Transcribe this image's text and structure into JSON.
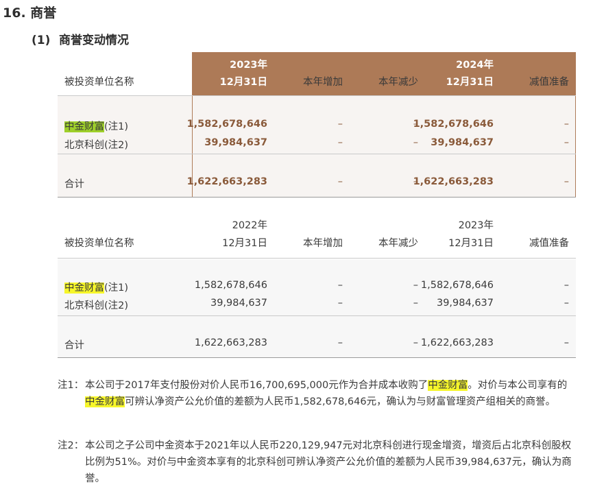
{
  "section": {
    "number": "16.",
    "title": "商誉"
  },
  "subsection": {
    "number": "(1)",
    "title": "商誉变动情况"
  },
  "table_2023": {
    "headers": {
      "name": "被投资单位名称",
      "col1_line1": "2023年",
      "col1_line2": "12月31日",
      "col2": "本年增加",
      "col3": "本年减少",
      "col4_line1": "2024年",
      "col4_line2": "12月31日",
      "col5": "减值准备"
    },
    "rows": [
      {
        "name_hl": "中金财富",
        "note": "(注1)",
        "opening": "1,582,678,646",
        "increase": "–",
        "decrease": "–",
        "closing": "1,582,678,646",
        "impairment": "–"
      },
      {
        "name": "北京科创(注2)",
        "opening": "39,984,637",
        "increase": "–",
        "decrease": "–",
        "closing": "39,984,637",
        "impairment": "–"
      }
    ],
    "total": {
      "name": "合计",
      "opening": "1,622,663,283",
      "increase": "–",
      "decrease": "–",
      "closing": "1,622,663,283",
      "impairment": "–"
    }
  },
  "table_2022": {
    "headers": {
      "name": "被投资单位名称",
      "col1_line1": "2022年",
      "col1_line2": "12月31日",
      "col2": "本年增加",
      "col3": "本年减少",
      "col4_line1": "2023年",
      "col4_line2": "12月31日",
      "col5": "减值准备"
    },
    "rows": [
      {
        "name_hl": "中金财富",
        "note": "(注1)",
        "opening": "1,582,678,646",
        "increase": "–",
        "decrease": "–",
        "closing": "1,582,678,646",
        "impairment": "–"
      },
      {
        "name": "北京科创(注2)",
        "opening": "39,984,637",
        "increase": "–",
        "decrease": "–",
        "closing": "39,984,637",
        "impairment": "–"
      }
    ],
    "total": {
      "name": "合计",
      "opening": "1,622,663,283",
      "increase": "–",
      "decrease": "–",
      "closing": "1,622,663,283",
      "impairment": "–"
    }
  },
  "notes": [
    {
      "tag": "注1：",
      "line1_a": "本公司于2017年支付股份对价人民币16,700,695,000元作为合并成本收购了",
      "line1_hl": "中金财富",
      "line1_b": "。对价与本公司享有的",
      "line2_hl": "中金财富",
      "line2_b": "可辨认净资产公允价值的差额为人民币1,582,678,646元，确认为与财富管理资产组相关的商誉。"
    },
    {
      "tag": "注2：",
      "text": "本公司之子公司中金资本于2021年以人民币220,129,947元对北京科创进行现金增资，增资后占北京科创股权比例为51%。对价与中金资本享有的北京科创可辨认净资产公允价值的差额为人民币39,984,637元，确认为商誉。"
    }
  ]
}
